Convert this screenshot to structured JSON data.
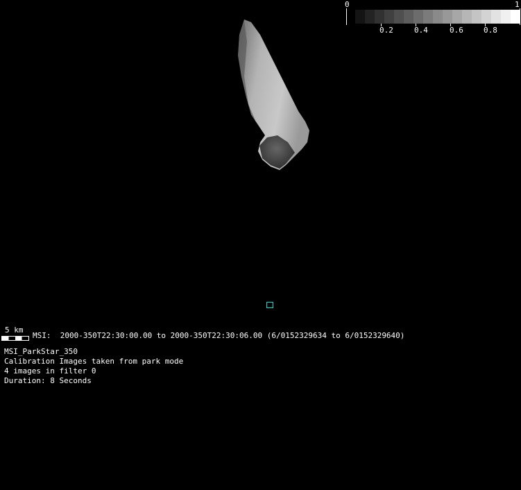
{
  "colorbar": {
    "min_label": "0",
    "max_label": "1",
    "tick_labels": [
      "0.2",
      "0.4",
      "0.6",
      "0.8"
    ],
    "steps": 17
  },
  "scale_bar": {
    "label": "5 km"
  },
  "observation": {
    "header": "MSI:  2000-350T22:30:00.00 to 2000-350T22:30:06.00 (6/0152329634 to 6/0152329640)",
    "lines": [
      "MSI_ParkStar_350",
      "Calibration Images taken from park mode",
      "4 images in filter 0",
      "Duration: 8 Seconds"
    ]
  },
  "colors": {
    "marker": "#00e0e0"
  }
}
